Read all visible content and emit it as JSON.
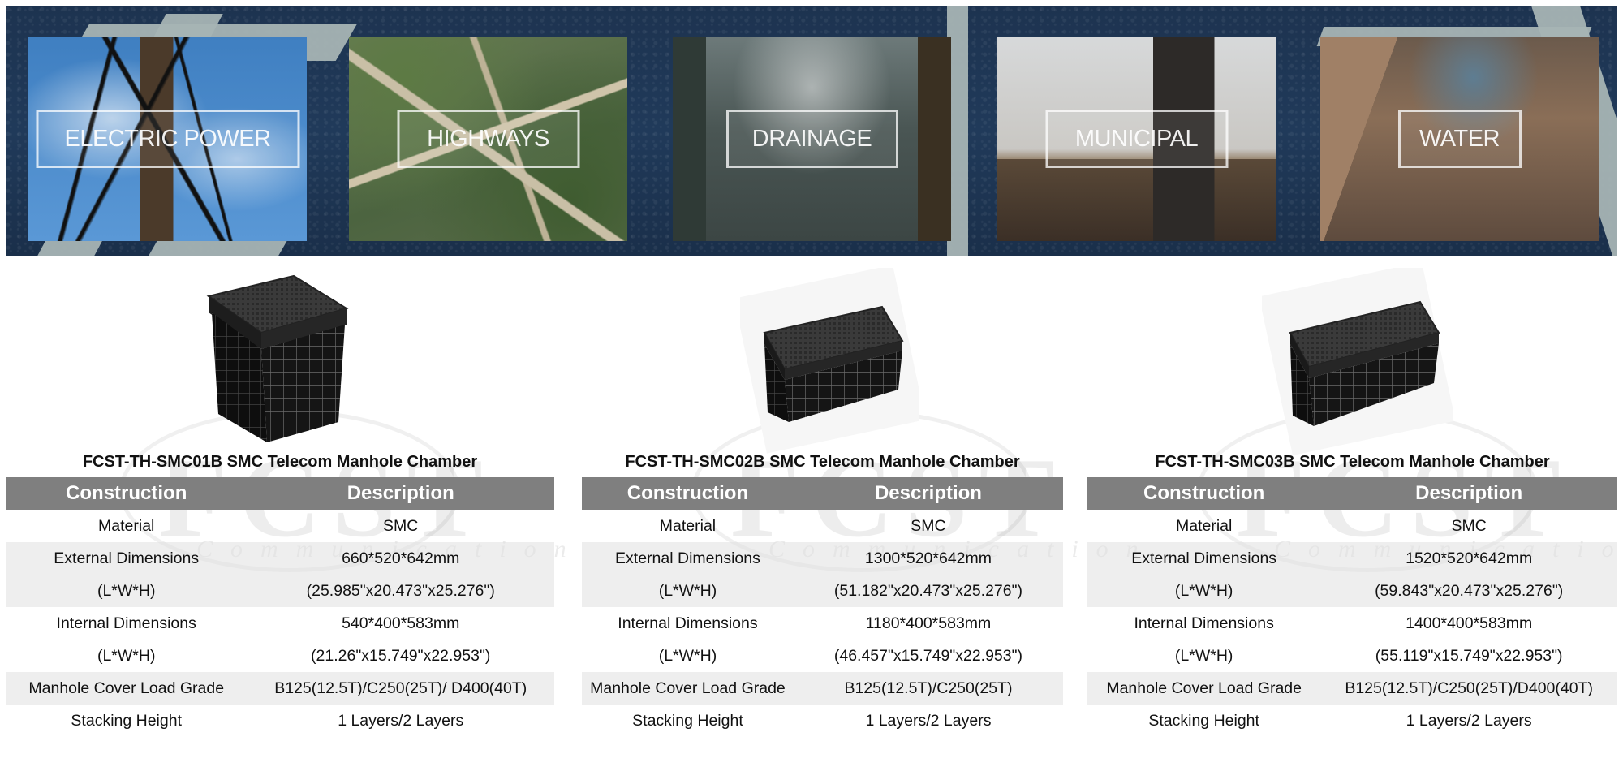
{
  "banner": {
    "categories": [
      {
        "id": "electric-power",
        "label": "ELECTRIC POWER"
      },
      {
        "id": "highways",
        "label": "HIGHWAYS"
      },
      {
        "id": "drainage",
        "label": "DRAINAGE"
      },
      {
        "id": "municipal",
        "label": "MUNICIPAL"
      },
      {
        "id": "water",
        "label": "WATER"
      }
    ]
  },
  "watermark": {
    "brand": "FCST",
    "sub": "Communication",
    "registered": "®"
  },
  "products": [
    {
      "title": "FCST-TH-SMC01B SMC Telecom Manhole Chamber",
      "image": "manhole-chamber-cube",
      "header": {
        "col1": "Construction",
        "col2": "Description"
      },
      "rows": {
        "material": {
          "label": "Material",
          "value": "SMC"
        },
        "external": {
          "label": "External Dimensions",
          "label2": "(L*W*H)",
          "value": "660*520*642mm",
          "value2": "(25.985\"x20.473\"x25.276\")"
        },
        "internal": {
          "label": "Internal Dimensions",
          "label2": "(L*W*H)",
          "value": "540*400*583mm",
          "value2": "(21.26\"x15.749\"x22.953\")"
        },
        "load": {
          "label": "Manhole Cover Load Grade",
          "value": "B125(12.5T)/C250(25T)/ D400(40T)"
        },
        "stacking": {
          "label": "Stacking Height",
          "value": "1 Layers/2 Layers"
        }
      }
    },
    {
      "title": "FCST-TH-SMC02B SMC Telecom Manhole Chamber",
      "image": "manhole-chamber-long",
      "header": {
        "col1": "Construction",
        "col2": "Description"
      },
      "rows": {
        "material": {
          "label": "Material",
          "value": "SMC"
        },
        "external": {
          "label": "External Dimensions",
          "label2": "(L*W*H)",
          "value": "1300*520*642mm",
          "value2": "(51.182\"x20.473\"x25.276\")"
        },
        "internal": {
          "label": "Internal Dimensions",
          "label2": "(L*W*H)",
          "value": "1180*400*583mm",
          "value2": "(46.457\"x15.749\"x22.953\")"
        },
        "load": {
          "label": "Manhole Cover Load Grade",
          "value": "B125(12.5T)/C250(25T)"
        },
        "stacking": {
          "label": "Stacking Height",
          "value": "1 Layers/2 Layers"
        }
      }
    },
    {
      "title": "FCST-TH-SMC03B SMC Telecom Manhole Chamber",
      "image": "manhole-chamber-long",
      "header": {
        "col1": "Construction",
        "col2": "Description"
      },
      "rows": {
        "material": {
          "label": "Material",
          "value": "SMC"
        },
        "external": {
          "label": "External Dimensions",
          "label2": "(L*W*H)",
          "value": "1520*520*642mm",
          "value2": "(59.843\"x20.473\"x25.276\")"
        },
        "internal": {
          "label": "Internal Dimensions",
          "label2": "(L*W*H)",
          "value": "1400*400*583mm",
          "value2": "(55.119\"x15.749\"x22.953\")"
        },
        "load": {
          "label": "Manhole Cover Load Grade",
          "value": "B125(12.5T)/C250(25T)/D400(40T)"
        },
        "stacking": {
          "label": "Stacking Height",
          "value": "1 Layers/2 Layers"
        }
      }
    }
  ],
  "colors": {
    "header_bg": "#7f7f7f",
    "header_text": "#ffffff",
    "band_bg": "#efefef",
    "banner_bg": "#1d3350"
  }
}
